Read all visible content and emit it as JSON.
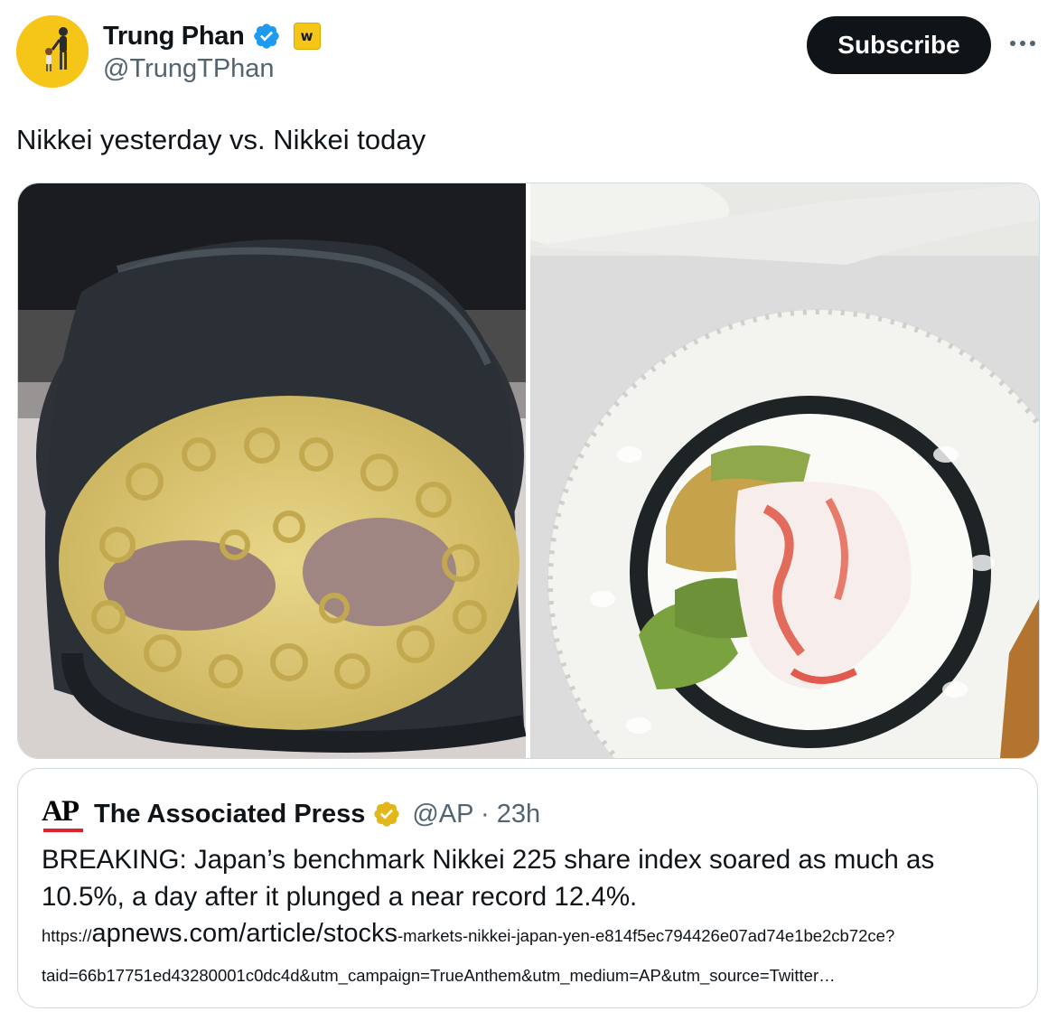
{
  "author": {
    "name": "Trung Phan",
    "handle": "@TrungTPhan",
    "badge_letter": "w",
    "subscribe_label": "Subscribe",
    "avatar_color": "#f5c518",
    "verified_color": "#1d9bf0"
  },
  "tweet": {
    "text": "Nikkei yesterday vs. Nikkei today"
  },
  "media": {
    "images": [
      {
        "icon": "macaroni-sushi-photo"
      },
      {
        "icon": "california-roll-photo"
      }
    ]
  },
  "quote": {
    "logo_text": "AP",
    "name": "The Associated Press",
    "handle_time": "@AP · 23h",
    "text": "BREAKING: Japan’s benchmark Nikkei 225 share index soared as much as 10.5%, a day after it plunged a near record 12.4%.",
    "link_prefix": "https://",
    "link_domain": "apnews.com/article/stocks",
    "link_rest": "-markets-nikkei-japan-yen-e814f5ec794426e07ad74e1be2cb72ce?",
    "link_line2": "taid=66b17751ed43280001c0dc4d&utm_campaign=TrueAnthem&utm_medium=AP&utm_source=Twitter…",
    "gold_check_color": "#e2b719",
    "logo_bar_color": "#e0202b"
  }
}
